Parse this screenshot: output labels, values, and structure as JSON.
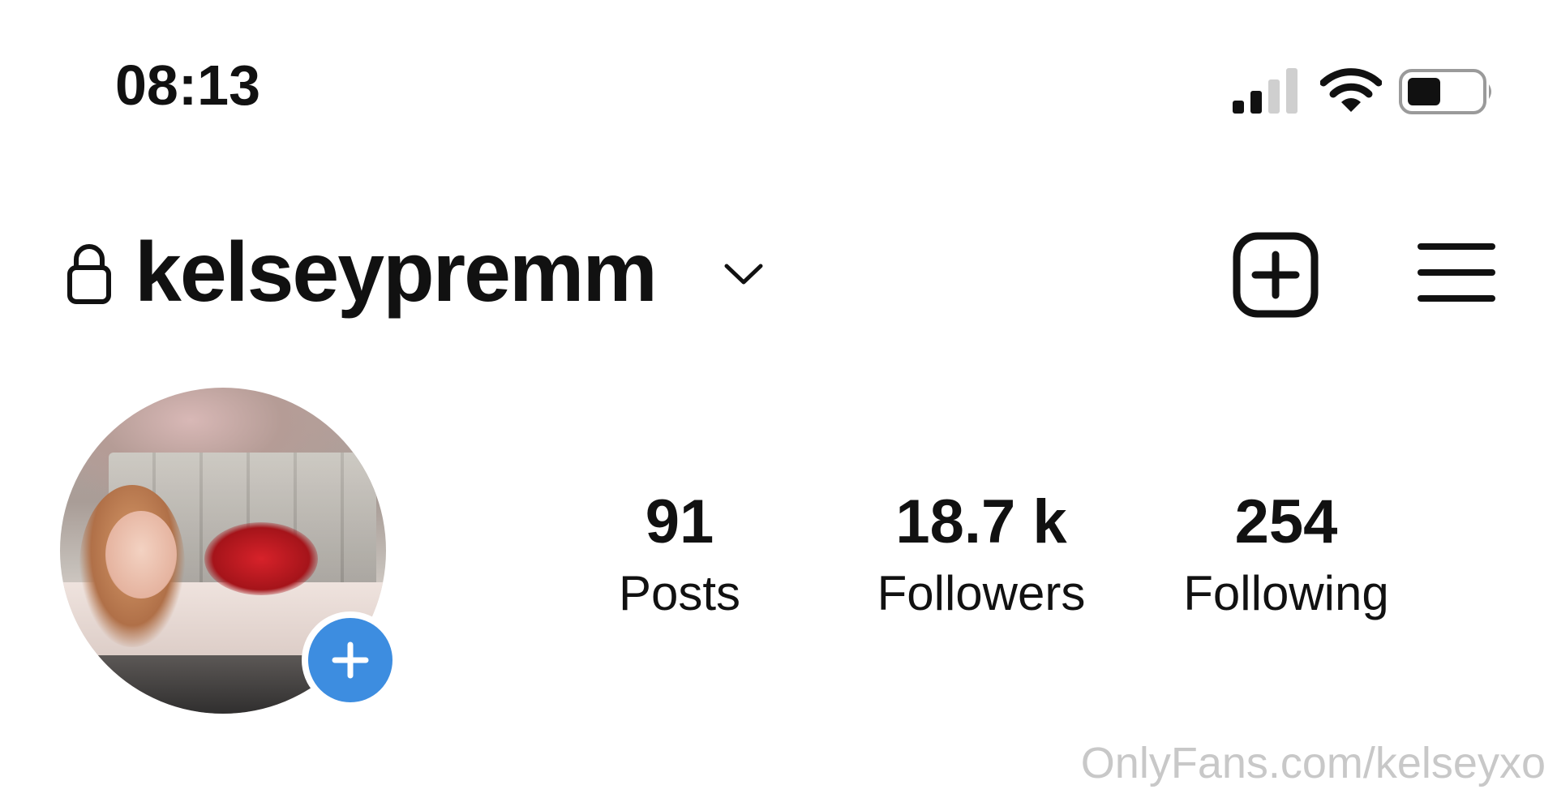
{
  "status_bar": {
    "time": "08:13",
    "signal_bars_active": 2,
    "signal_bars_total": 4,
    "battery_level": 0.4
  },
  "header": {
    "username": "kelseypremm",
    "icons": [
      "lock-icon",
      "chevron-down-icon",
      "plus-square-icon",
      "hamburger-menu-icon"
    ]
  },
  "profile": {
    "stats": [
      {
        "value": "91",
        "label": "Posts"
      },
      {
        "value": "18.7 k",
        "label": "Followers"
      },
      {
        "value": "254",
        "label": "Following"
      }
    ],
    "add_story_icon": "plus-icon"
  },
  "watermark": "OnlyFans.com/kelseyxo",
  "colors": {
    "text": "#111111",
    "background": "#ffffff",
    "accent_blue": "#3d8de0",
    "watermark": "#c8c8c8"
  }
}
